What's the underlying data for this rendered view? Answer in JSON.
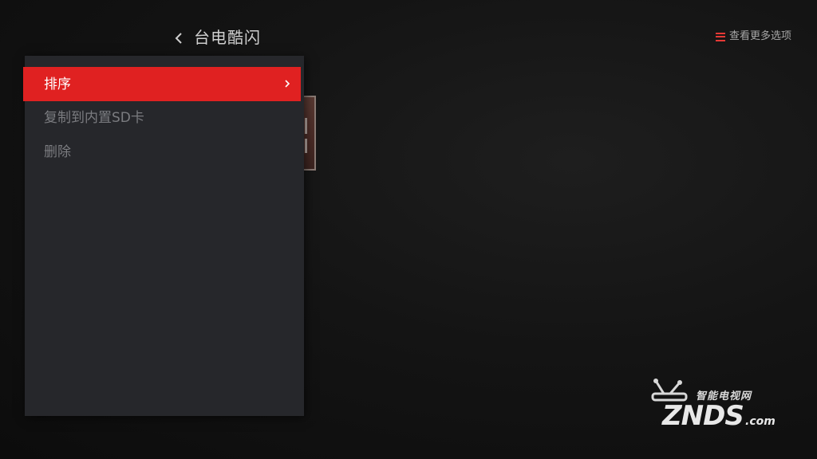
{
  "header": {
    "title": "台电酷闪",
    "more_options_label": "查看更多选项"
  },
  "context_menu": {
    "items": [
      {
        "label": "排序",
        "selected": true
      },
      {
        "label": "复制到内置SD卡",
        "selected": false
      },
      {
        "label": "删除",
        "selected": false
      }
    ]
  },
  "watermark": {
    "tagline": "智能电视网",
    "logo": "ZNDS",
    "domain": ".com"
  },
  "colors": {
    "accent": "#e02121",
    "menu_bg": "#26272b",
    "background": "#111111"
  },
  "icons": {
    "back": "chevron-left-icon",
    "more": "hamburger-menu-icon",
    "submenu": "chevron-right-icon"
  }
}
